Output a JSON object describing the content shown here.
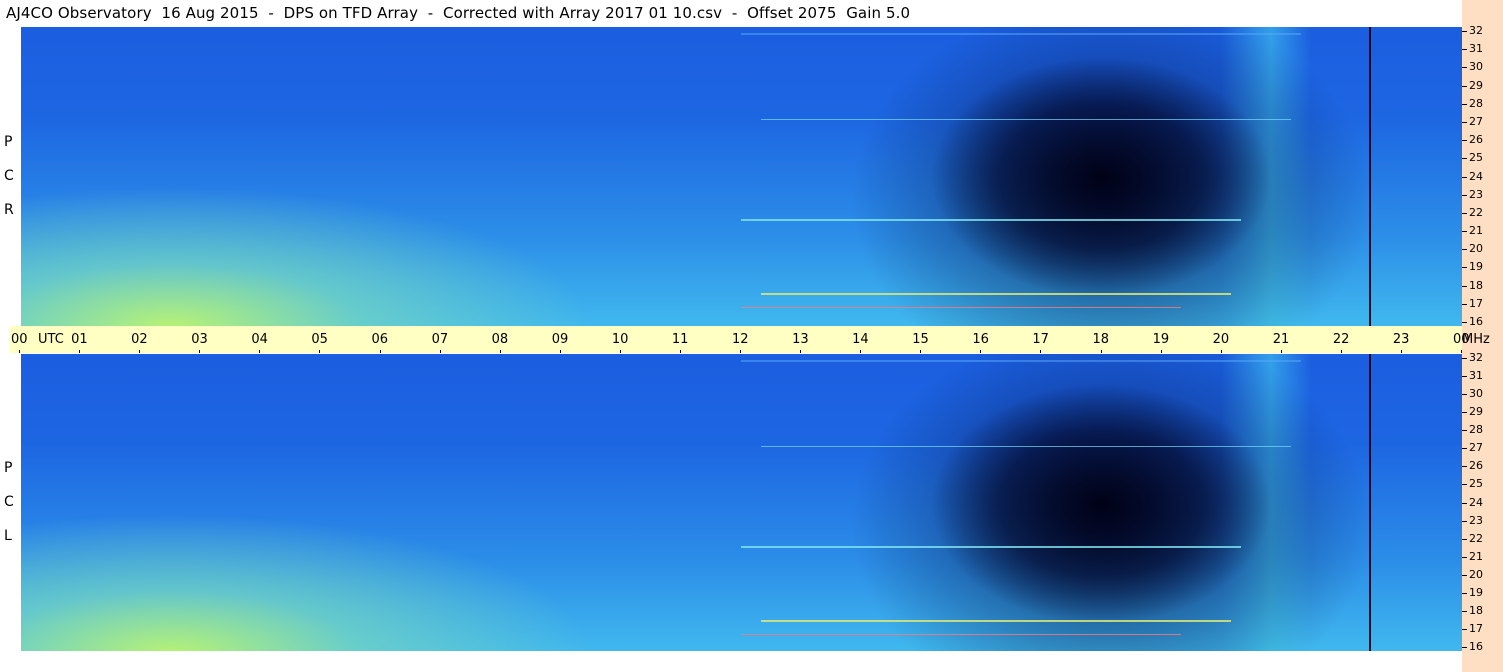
{
  "title": "AJ4CO Observatory  16 Aug 2015  -  DPS on TFD Array  -  Corrected with Array 2017 01 10.csv  -  Offset 2075  Gain 5.0",
  "time_axis": {
    "labels": [
      "00",
      "UTC",
      "01",
      "02",
      "03",
      "04",
      "05",
      "06",
      "07",
      "08",
      "09",
      "10",
      "11",
      "12",
      "13",
      "14",
      "15",
      "16",
      "17",
      "18",
      "19",
      "20",
      "21",
      "22",
      "23",
      "00",
      "MHz"
    ]
  },
  "panels": [
    {
      "id": "rcp",
      "letters": [
        "P",
        "C",
        "R"
      ]
    },
    {
      "id": "lcp",
      "letters": [
        "P",
        "C",
        "L"
      ]
    }
  ],
  "freq_labels": [
    "32",
    "31",
    "30",
    "29",
    "28",
    "27",
    "26",
    "25",
    "24",
    "23",
    "22",
    "21",
    "20",
    "19",
    "18",
    "17",
    "16"
  ],
  "chart_data": {
    "type": "heatmap",
    "title": "AJ4CO Observatory  16 Aug 2015  -  DPS on TFD Array  -  Corrected with Array 2017 01 10.csv  -  Offset 2075  Gain 5.0",
    "x": {
      "label": "UTC",
      "range": [
        0,
        24
      ],
      "ticks": [
        "00",
        "01",
        "02",
        "03",
        "04",
        "05",
        "06",
        "07",
        "08",
        "09",
        "10",
        "11",
        "12",
        "13",
        "14",
        "15",
        "16",
        "17",
        "18",
        "19",
        "20",
        "21",
        "22",
        "23",
        "00"
      ]
    },
    "y": {
      "label": "MHz",
      "range": [
        16,
        32
      ],
      "ticks": [
        32,
        31,
        30,
        29,
        28,
        27,
        26,
        25,
        24,
        23,
        22,
        21,
        20,
        19,
        18,
        17,
        16
      ]
    },
    "panels": [
      "R C P",
      "L C P"
    ],
    "colors": {
      "strong": "#b8f070",
      "medium": "#3cc0f0",
      "weak": "#1b5ee0",
      "very_weak": "#000018",
      "axis_band": "#ffffc4",
      "right_strip": "#ffdfc4"
    }
  }
}
